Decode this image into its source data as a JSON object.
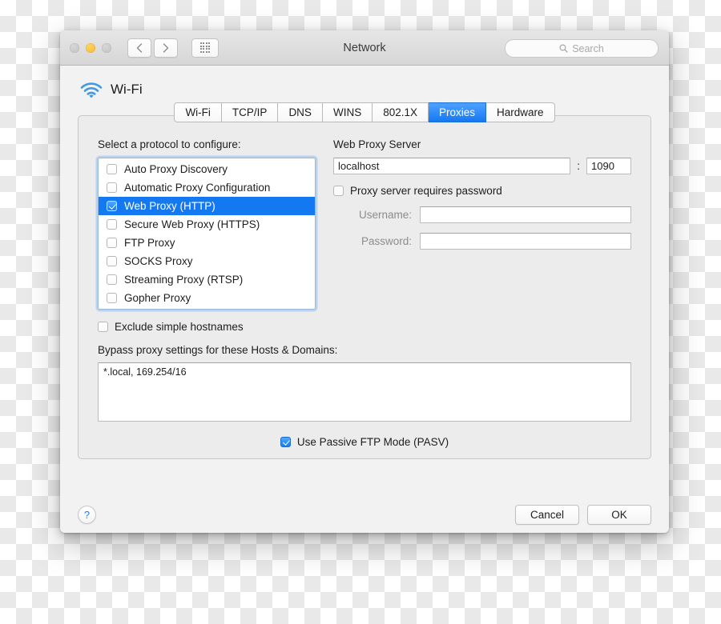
{
  "window": {
    "title": "Network",
    "traffic_lights": [
      {
        "name": "close",
        "color": "#c9c9c9"
      },
      {
        "name": "minimize",
        "color": "#f5bb2f"
      },
      {
        "name": "zoom",
        "color": "#c9c9c9"
      }
    ],
    "nav": {
      "back": "‹",
      "forward": "›",
      "grid": "show-all-icon"
    },
    "search": {
      "placeholder": "Search",
      "value": "",
      "icon": "search-icon"
    }
  },
  "service": {
    "name": "Wi-Fi",
    "icon": "wifi-icon"
  },
  "tabs": [
    {
      "label": "Wi-Fi",
      "selected": false
    },
    {
      "label": "TCP/IP",
      "selected": false
    },
    {
      "label": "DNS",
      "selected": false
    },
    {
      "label": "WINS",
      "selected": false
    },
    {
      "label": "802.1X",
      "selected": false
    },
    {
      "label": "Proxies",
      "selected": true
    },
    {
      "label": "Hardware",
      "selected": false
    }
  ],
  "protocols": {
    "label": "Select a protocol to configure:",
    "items": [
      {
        "label": "Auto Proxy Discovery",
        "checked": false,
        "selected": false
      },
      {
        "label": "Automatic Proxy Configuration",
        "checked": false,
        "selected": false
      },
      {
        "label": "Web Proxy (HTTP)",
        "checked": true,
        "selected": true
      },
      {
        "label": "Secure Web Proxy (HTTPS)",
        "checked": false,
        "selected": false
      },
      {
        "label": "FTP Proxy",
        "checked": false,
        "selected": false
      },
      {
        "label": "SOCKS Proxy",
        "checked": false,
        "selected": false
      },
      {
        "label": "Streaming Proxy (RTSP)",
        "checked": false,
        "selected": false
      },
      {
        "label": "Gopher Proxy",
        "checked": false,
        "selected": false
      }
    ]
  },
  "proxy_server": {
    "title": "Web Proxy Server",
    "host": "localhost",
    "host_placeholder": "",
    "separator": ":",
    "port": "1090",
    "requires_password_label": "Proxy server requires password",
    "requires_password_checked": false,
    "username_label": "Username:",
    "username_value": "",
    "password_label": "Password:",
    "password_value": ""
  },
  "bypass": {
    "exclude_label": "Exclude simple hostnames",
    "exclude_checked": false,
    "label": "Bypass proxy settings for these Hosts & Domains:",
    "value": "*.local, 169.254/16"
  },
  "pasv": {
    "label": "Use Passive FTP Mode (PASV)",
    "checked": true
  },
  "footer": {
    "help": "?",
    "cancel": "Cancel",
    "ok": "OK"
  },
  "colors": {
    "accent_blue": "#1478f0",
    "selected_tab_blue": "#1578f2",
    "wifi_blue": "#2f8fe0",
    "help_blue": "#2f7fe8"
  }
}
